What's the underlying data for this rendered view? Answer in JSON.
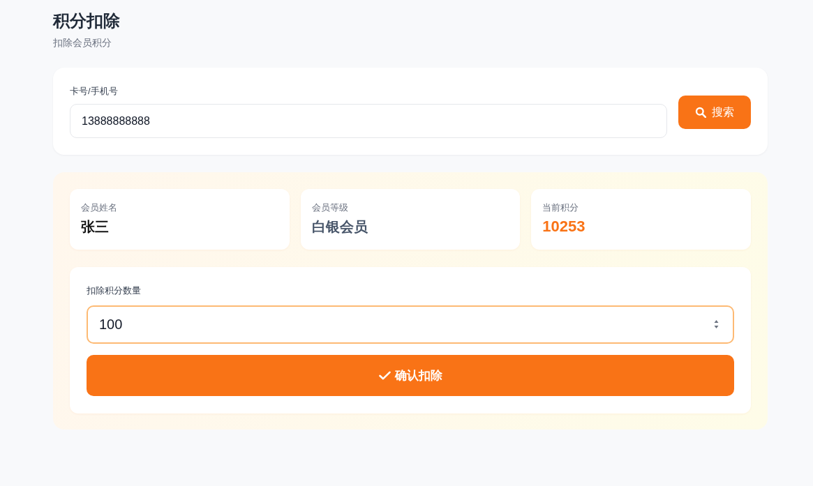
{
  "header": {
    "title": "积分扣除",
    "subtitle": "扣除会员积分"
  },
  "search": {
    "label": "卡号/手机号",
    "value": "13888888888",
    "button": "搜索"
  },
  "member": {
    "stats": [
      {
        "kind": "name",
        "label": "会员姓名",
        "value": "张三"
      },
      {
        "kind": "level",
        "label": "会员等级",
        "value": "白银会员"
      },
      {
        "kind": "points",
        "label": "当前积分",
        "value": "10253"
      }
    ]
  },
  "deduct": {
    "label": "扣除积分数量",
    "value": "100",
    "button": "确认扣除"
  }
}
